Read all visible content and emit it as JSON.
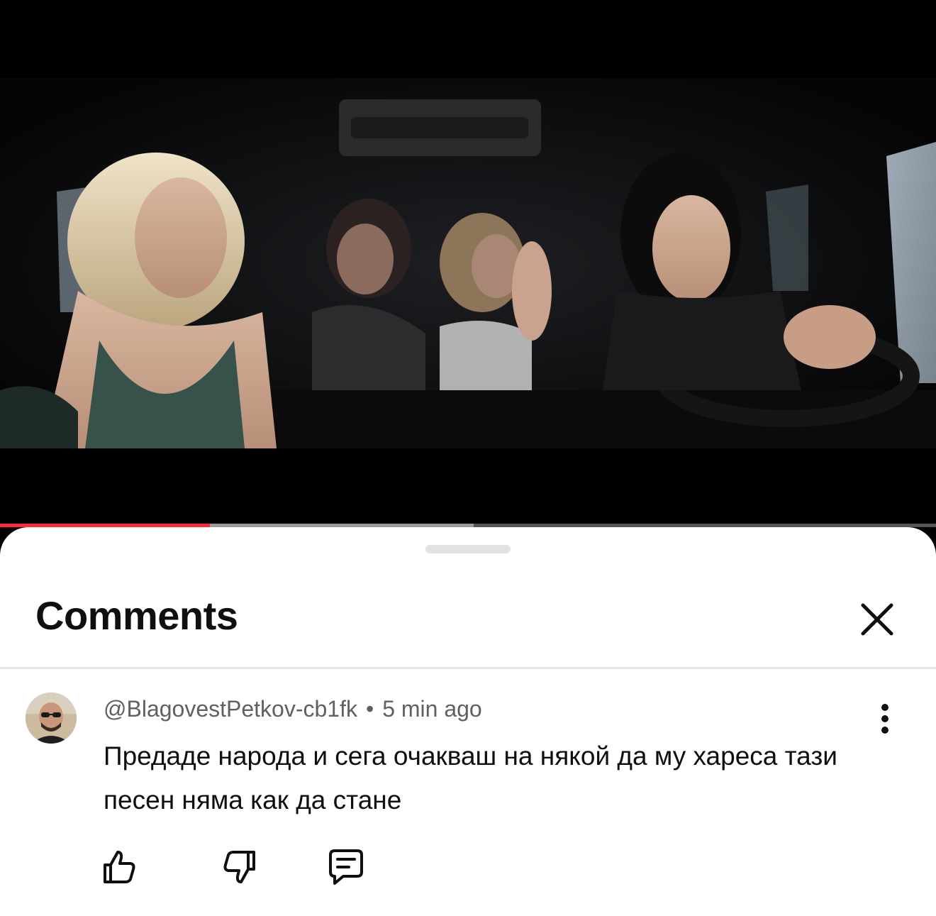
{
  "video": {
    "progress_played": 0.224,
    "progress_buffered": 0.506,
    "played_color": "#ff2a3a",
    "frame_description_icon": "video-frame"
  },
  "sheet": {
    "title": "Comments",
    "close_icon": "close-icon"
  },
  "comment": {
    "author": "@BlagovestPetkov-cb1fk",
    "separator": "•",
    "time": "5 min ago",
    "text": "Предаде народа и сега очакваш на някой да му хареса тази песен няма как да стане",
    "actions": [
      "like-icon",
      "dislike-icon",
      "reply-icon"
    ],
    "menu_icon": "more-vertical-icon"
  }
}
